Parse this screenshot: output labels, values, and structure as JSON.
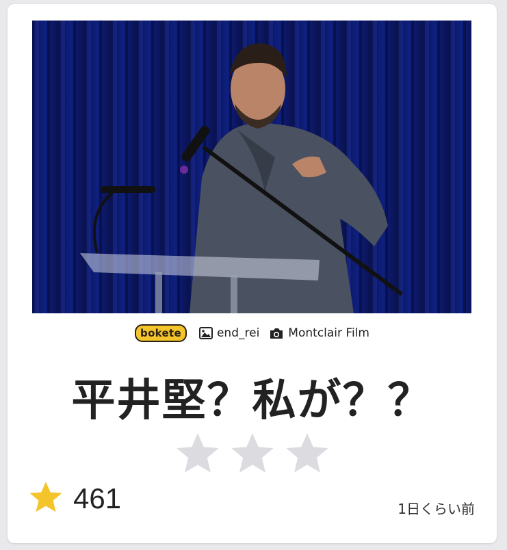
{
  "post": {
    "brand": "bokete",
    "author_icon": "image-icon",
    "author": "end_rei",
    "photo_credit_icon": "camera-icon",
    "photo_credit": "Montclair Film",
    "caption": "平井堅？私が？？",
    "rating_max": 3,
    "rating_value": 0,
    "score_icon": "star-icon",
    "score": "461",
    "posted_ago": "1日くらい前"
  },
  "colors": {
    "brand_yellow": "#f4c42b",
    "score_star": "#f4c42b",
    "empty_star": "#dcdce0"
  }
}
